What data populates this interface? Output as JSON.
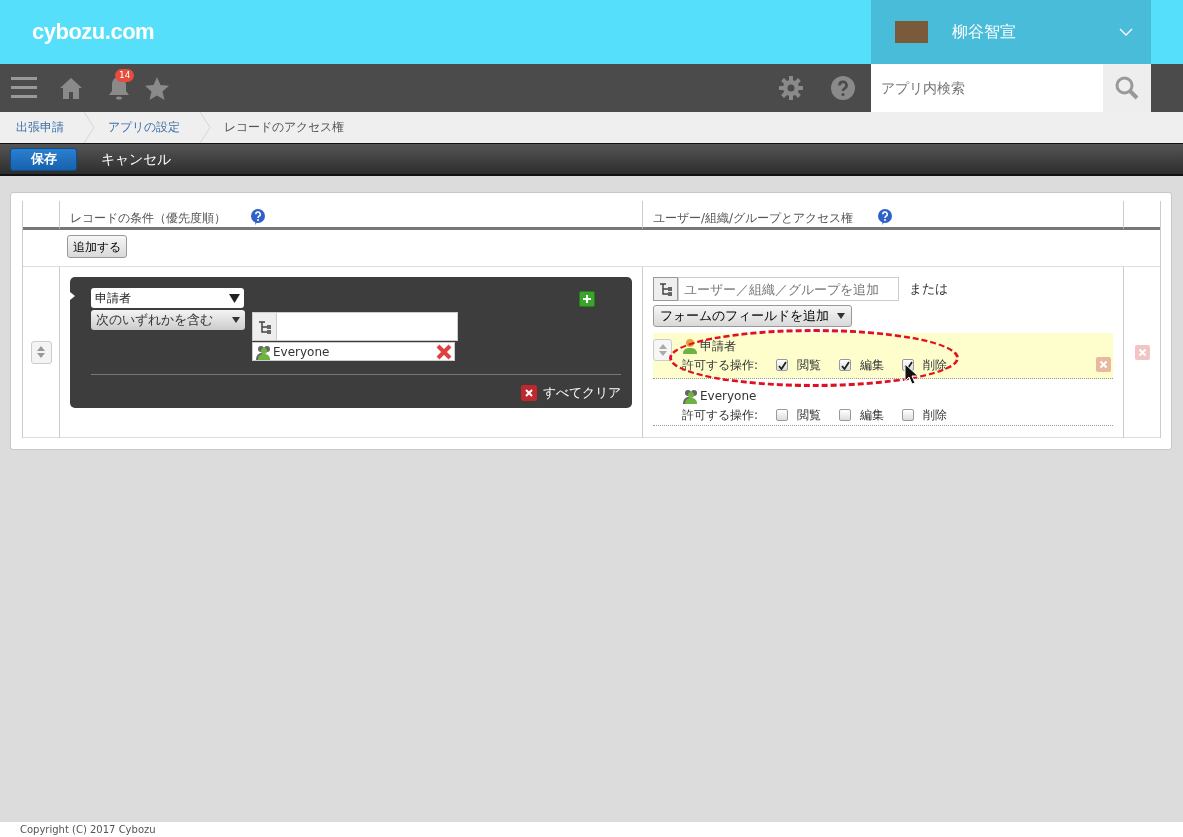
{
  "header": {
    "logo": "cybozu.com",
    "user": {
      "name": "柳谷智宣"
    }
  },
  "navbar": {
    "notification_count": "14",
    "search": {
      "placeholder": "アプリ内検索"
    }
  },
  "breadcrumbs": [
    {
      "label": "出張申請",
      "current": false
    },
    {
      "label": "アプリの設定",
      "current": false
    },
    {
      "label": "レコードのアクセス権",
      "current": true
    }
  ],
  "toolbar": {
    "buttons": [
      {
        "label": "保存",
        "kind": "primary"
      },
      {
        "label": "キャンセル",
        "kind": "plain"
      }
    ]
  },
  "table": {
    "columns": [
      "レコードの条件（優先度順）",
      "ユーザー/組織/グループとアクセス権"
    ],
    "add_button": "追加する",
    "rows": [
      {
        "condition": {
          "field": "申請者",
          "operator": "次のいずれかを含む",
          "values": [
            {
              "name": "Everyone"
            }
          ],
          "clear_all": "すべてクリア"
        },
        "access": {
          "add_placeholder": "ユーザー／組織／グループを追加",
          "or_text": "または",
          "field_button": "フォームのフィールドを追加",
          "entries": [
            {
              "name": "申請者",
              "kind": "user",
              "highlighted": true,
              "label": "許可する操作:",
              "permissions": [
                {
                  "label": "閲覧",
                  "checked": true
                },
                {
                  "label": "編集",
                  "checked": true
                },
                {
                  "label": "削除",
                  "checked": true
                }
              ]
            },
            {
              "name": "Everyone",
              "kind": "group",
              "highlighted": false,
              "label": "許可する操作:",
              "permissions": [
                {
                  "label": "閲覧",
                  "checked": false
                },
                {
                  "label": "編集",
                  "checked": false
                },
                {
                  "label": "削除",
                  "checked": false
                }
              ]
            }
          ]
        }
      }
    ]
  },
  "footer": "Copyright (C) 2017 Cybozu"
}
